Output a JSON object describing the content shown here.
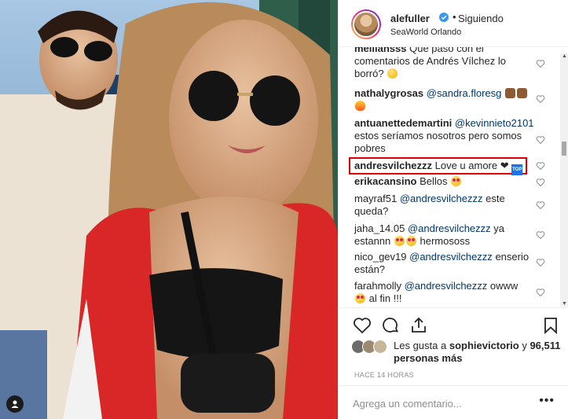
{
  "post": {
    "username": "alefuller",
    "follow_status": "Siguiendo",
    "dot": "•",
    "location": "SeaWorld Orlando"
  },
  "comments": [
    {
      "user": "melliansss",
      "text": "Qué pasó con el comentarios de Andrés Vílchez lo borró?",
      "emoji": "yellow"
    },
    {
      "user": "nathalygrosas",
      "mention": "@sandra.floresg",
      "text": "",
      "emoji": "brown"
    },
    {
      "user": "antuanettedemartini",
      "mention": "@kevinnieto2101",
      "text": "estos seríamos nosotros pero somos pobres"
    },
    {
      "user": "andresvilchezzz",
      "text": "Love u amore ❤",
      "badge": "TOP"
    },
    {
      "user": "erikacansino",
      "text": "Bellos",
      "emoji": "hearteyes"
    },
    {
      "user": "mayraf51",
      "mention": "@andresvilchezzz",
      "text": "este queda?"
    },
    {
      "user": "jaha_14.05",
      "mention": "@andresvilchezzz",
      "text": "ya estannn",
      "text2": "hermososs"
    },
    {
      "user": "nico_gev19",
      "mention": "@andresvilchezzz",
      "text": "enserio están?"
    },
    {
      "user": "farahmolly",
      "mention": "@andresvilchezzz",
      "text": "owww",
      "text2": "al fin !!!"
    }
  ],
  "likes": {
    "prefix": "Les gusta a",
    "user": "sophievictorio",
    "connector": "y",
    "count": "96,511 personas más"
  },
  "timestamp": "HACE 14 HORAS",
  "add_comment": {
    "placeholder": "Agrega un comentario..."
  },
  "more_options": "•••",
  "colors": {
    "highlight": "#e00000",
    "link": "#00376b",
    "text": "#262626",
    "muted": "#8e8e8e"
  }
}
